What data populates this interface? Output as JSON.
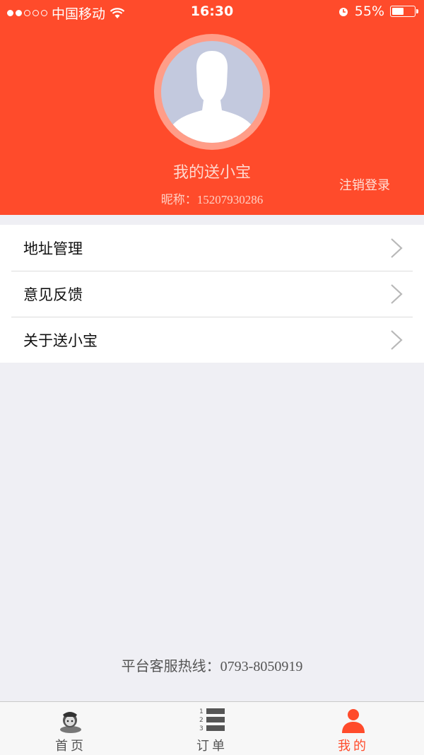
{
  "status_bar": {
    "carrier": "中国移动",
    "time": "16:30",
    "battery": "55%",
    "battery_level": 0.55
  },
  "profile": {
    "title": "我的送小宝",
    "nickname_label": "昵称：",
    "nickname_value": "15207930286",
    "logout_label": "注销登录"
  },
  "menu": {
    "items": [
      {
        "label": "地址管理"
      },
      {
        "label": "意见反馈"
      },
      {
        "label": "关于送小宝"
      }
    ]
  },
  "hotline": {
    "label": "平台客服热线：",
    "number": "0793-8050919"
  },
  "tabs": [
    {
      "label": "首页",
      "icon": "home-character-icon"
    },
    {
      "label": "订单",
      "icon": "order-list-icon"
    },
    {
      "label": "我的",
      "icon": "person-icon"
    }
  ],
  "colors": {
    "accent": "#ff4b2b",
    "background": "#efeff4"
  }
}
